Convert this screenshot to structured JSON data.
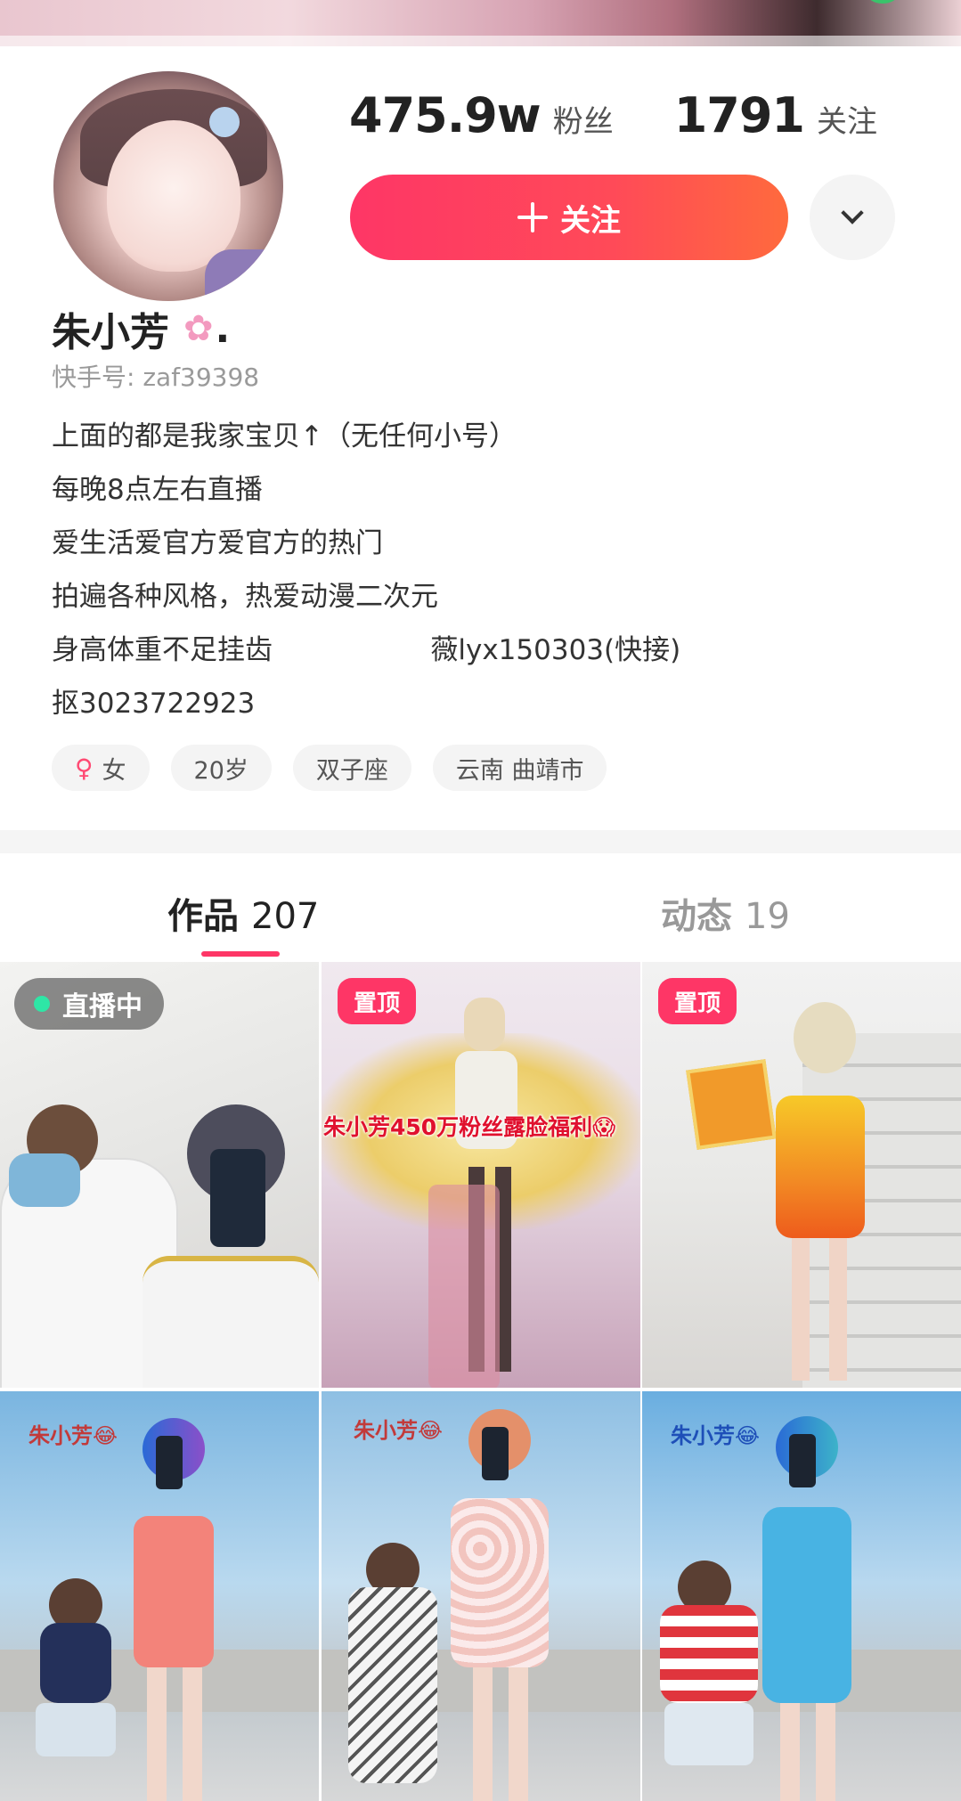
{
  "profile": {
    "followers_count": "475.9w",
    "followers_label": "粉丝",
    "following_count": "1791",
    "following_label": "关注",
    "follow_button_label": "关注",
    "name": "朱小芳",
    "name_suffix": ".",
    "kuaishou_id": "快手号: zaf39398",
    "bio_lines": [
      "上面的都是我家宝贝↑（无任何小号）",
      "每晚8点左右直播",
      "爱生活爱官方爱官方的热门",
      "拍遍各种风格，热爱动漫二次元",
      "身高体重不足挂齿                  薇lyx150303(快接)",
      "抠3023722923"
    ],
    "tags": {
      "gender": "女",
      "age": "20岁",
      "zodiac": "双子座",
      "location": "云南 曲靖市"
    }
  },
  "tabs": {
    "works_label": "作品",
    "works_count": "207",
    "moments_label": "动态",
    "moments_count": "19"
  },
  "grid": {
    "live_badge": "直播中",
    "pinned_badge": "置顶",
    "caption_2": "朱小芳450万粉丝露脸福利😱",
    "watermark": "朱小芳😂"
  },
  "colors": {
    "accent": "#fe3666",
    "accent_end": "#ff6a3d",
    "live_dot": "#2ee6a6"
  },
  "icons": {
    "follow": "plus-icon",
    "more": "chevron-down-icon",
    "name_decoration": "cherry-blossom-icon",
    "gender": "female-icon"
  }
}
